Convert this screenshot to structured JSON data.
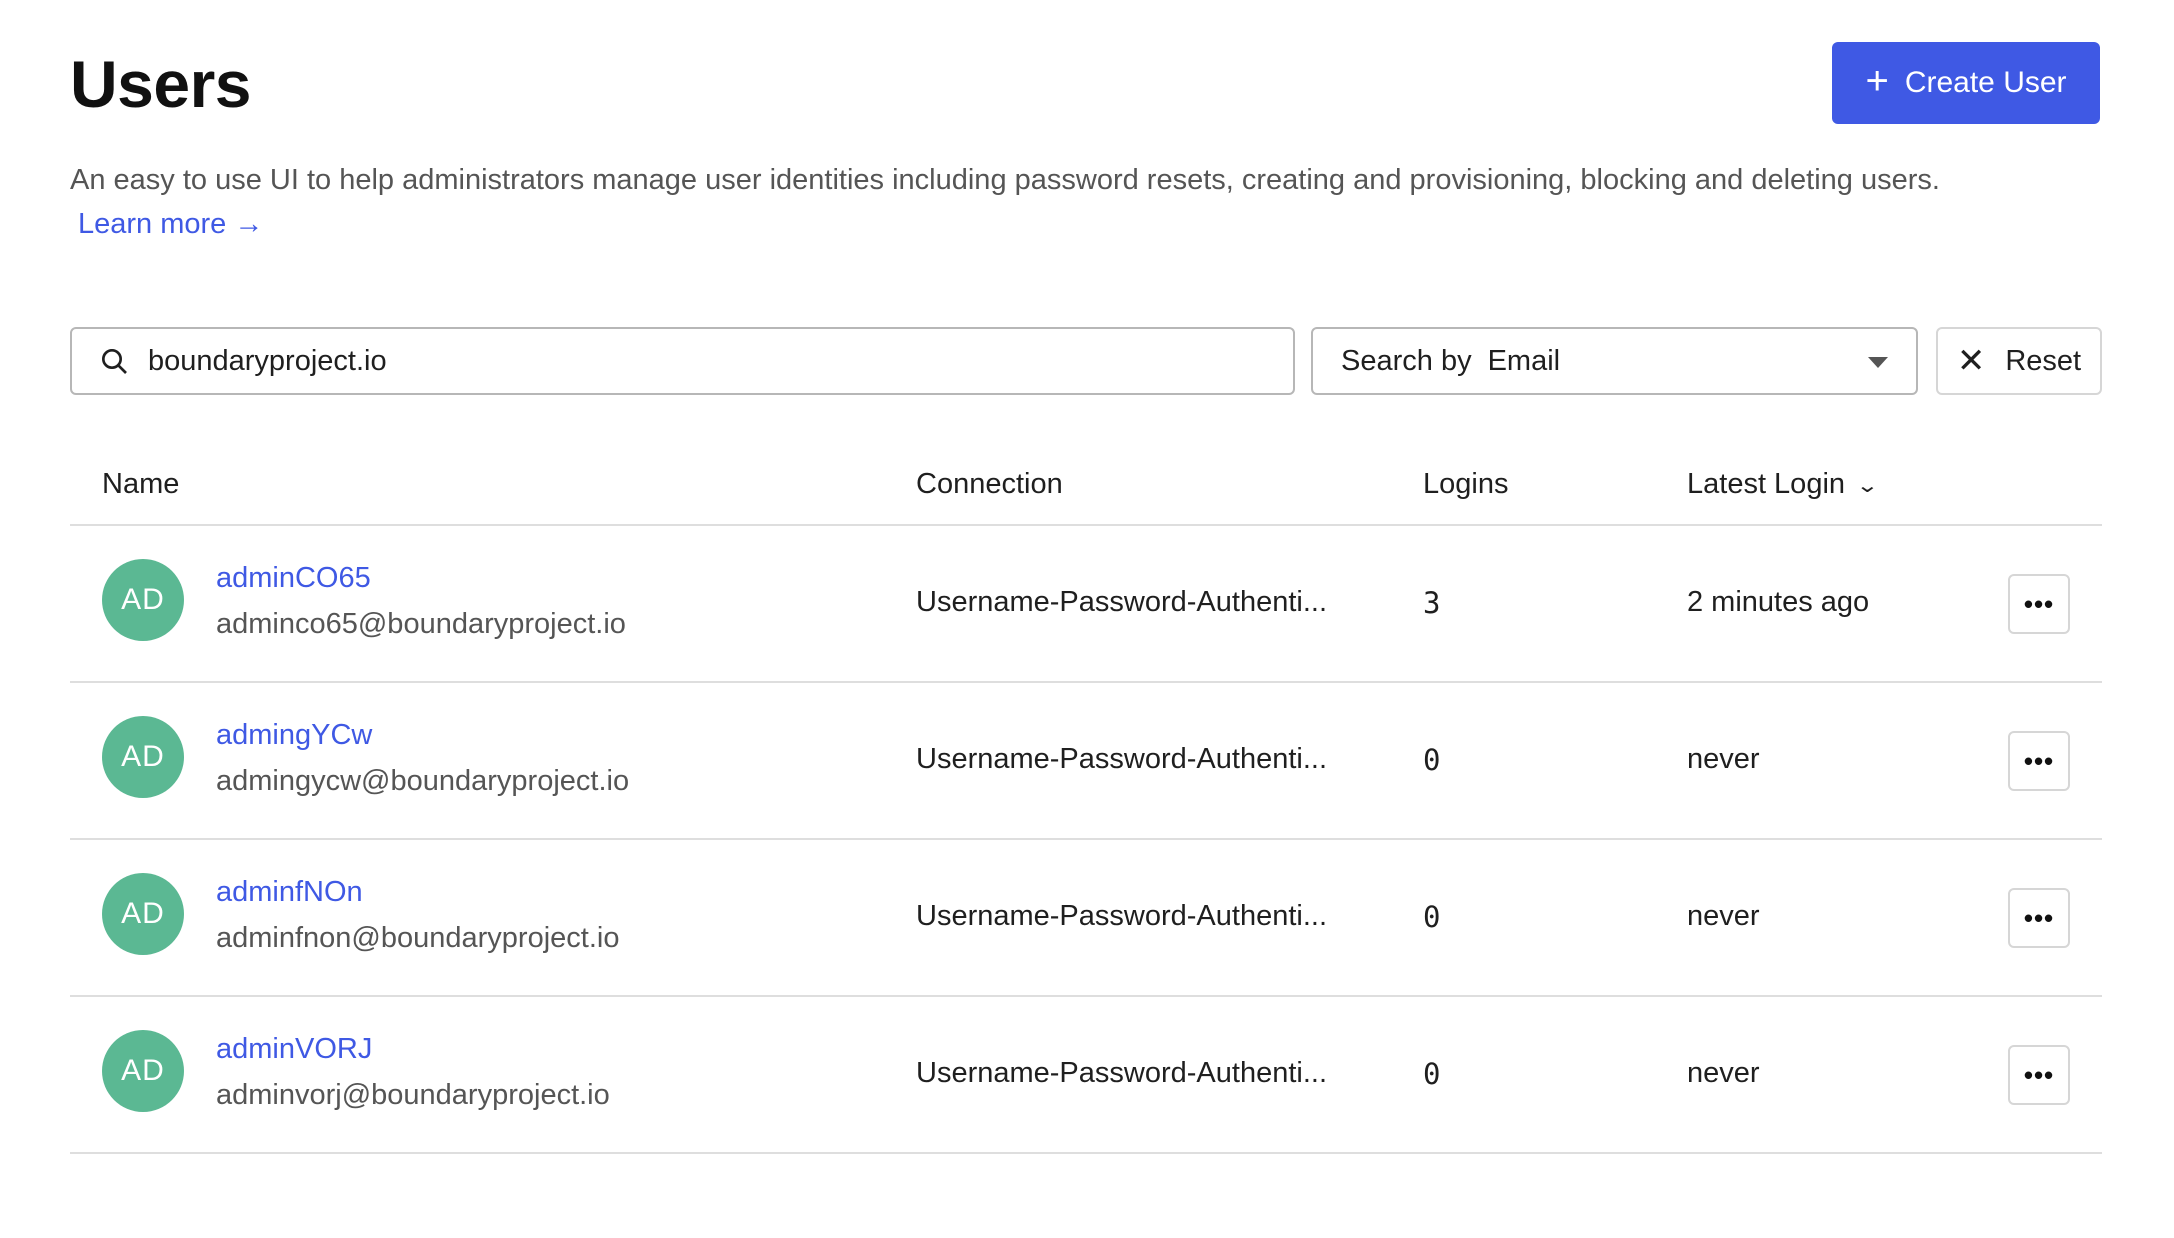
{
  "header": {
    "title": "Users",
    "create_button": "Create User",
    "description": "An easy to use UI to help administrators manage user identities including password resets, creating and provisioning, blocking and deleting users.",
    "learn_more": "Learn more →"
  },
  "filters": {
    "search_value": "boundaryproject.io",
    "search_by_label": "Search by",
    "search_by_value": "Email",
    "reset_label": "Reset"
  },
  "table": {
    "columns": [
      "Name",
      "Connection",
      "Logins",
      "Latest Login"
    ],
    "rows": [
      {
        "initials": "AD",
        "name": "adminCO65",
        "email": "adminco65@boundaryproject.io",
        "connection": "Username-Password-Authenti...",
        "logins": "3",
        "latest": "2 minutes ago"
      },
      {
        "initials": "AD",
        "name": "admingYCw",
        "email": "admingycw@boundaryproject.io",
        "connection": "Username-Password-Authenti...",
        "logins": "0",
        "latest": "never"
      },
      {
        "initials": "AD",
        "name": "adminfNOn",
        "email": "adminfnon@boundaryproject.io",
        "connection": "Username-Password-Authenti...",
        "logins": "0",
        "latest": "never"
      },
      {
        "initials": "AD",
        "name": "adminVORJ",
        "email": "adminvorj@boundaryproject.io",
        "connection": "Username-Password-Authenti...",
        "logins": "0",
        "latest": "never"
      }
    ]
  },
  "colors": {
    "accent": "#3f59e4",
    "avatar": "#5bb893"
  },
  "icons": {
    "create": "plus-icon",
    "search": "search-icon",
    "select": "caret-down-icon",
    "reset": "close-icon",
    "sort": "chevron-down-icon",
    "row_menu": "more-horizontal-icon"
  }
}
